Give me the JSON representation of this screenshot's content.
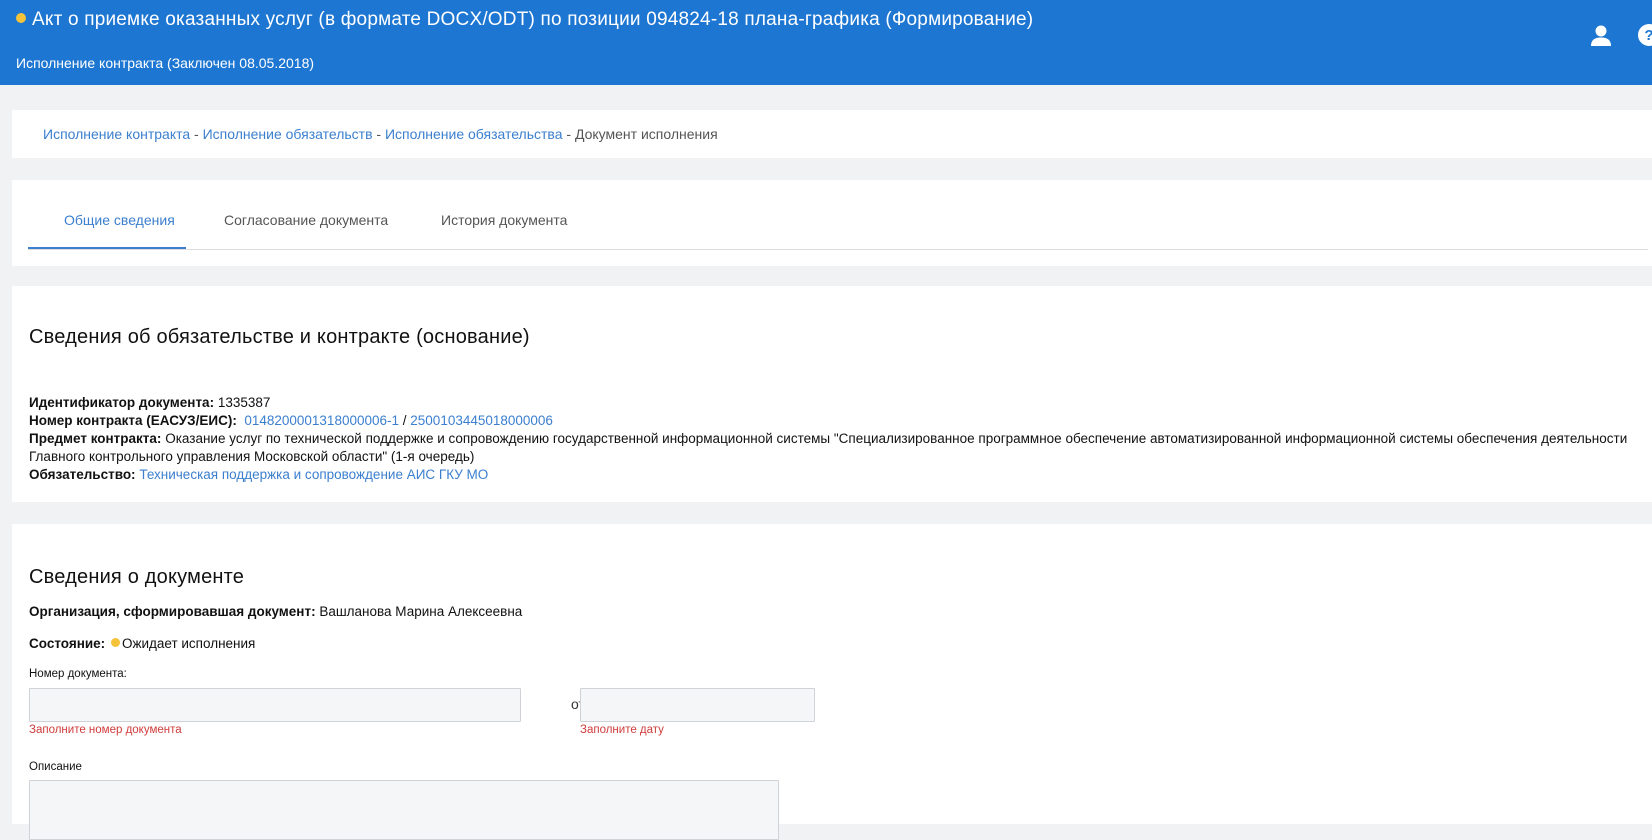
{
  "header": {
    "title": "Акт о приемке оказанных услуг (в формате DOCX/ODT) по позиции 094824-18 плана-графика (Формирование)",
    "subtitle": "Исполнение контракта (Заключен 08.05.2018)",
    "status_color": "#f5c33b",
    "icons": [
      "user-icon",
      "help-icon"
    ]
  },
  "breadcrumb": {
    "items": [
      "Исполнение контракта",
      "Исполнение обязательств",
      "Исполнение обязательства"
    ],
    "current": "Документ исполнения",
    "separator": " - "
  },
  "tabs": [
    {
      "label": "Общие сведения",
      "active": true
    },
    {
      "label": "Согласование документа",
      "active": false
    },
    {
      "label": "История документа",
      "active": false
    }
  ],
  "contract_info": {
    "title": "Сведения об обязательстве и контракте (основание)",
    "doc_id_label": "Идентификатор документа:",
    "doc_id_value": "1335387",
    "contract_number_label": "Номер контракта (ЕАСУЗ/ЕИС):",
    "contract_number_easuz": "0148200001318000006-1",
    "contract_number_sep": " / ",
    "contract_number_eis": "2500103445018000006",
    "subject_label": "Предмет контракта:",
    "subject_value": "Оказание услуг по технической поддержке и сопровождению государственной информационной системы \"Специализированное программное обеспечение автоматизированной информационной системы обеспечения деятельности Главного контрольного управления Московской области\" (1-я очередь)",
    "obligation_label": "Обязательство:",
    "obligation_value": "Техническая поддержка и сопровождение АИС ГКУ МО"
  },
  "document_info": {
    "title": "Сведения о документе",
    "org_label": "Организация, сформировавшая документ:",
    "org_value": "Вашланова Марина Алексеевна",
    "state_label": "Состояние:",
    "state_value": "Ожидает исполнения",
    "state_color": "#f5c33b",
    "number_label": "Номер документа:",
    "number_value": "",
    "number_error": "Заполните номер документа",
    "from_label": "от",
    "date_value": "",
    "date_error": "Заполните дату",
    "description_label": "Описание"
  }
}
